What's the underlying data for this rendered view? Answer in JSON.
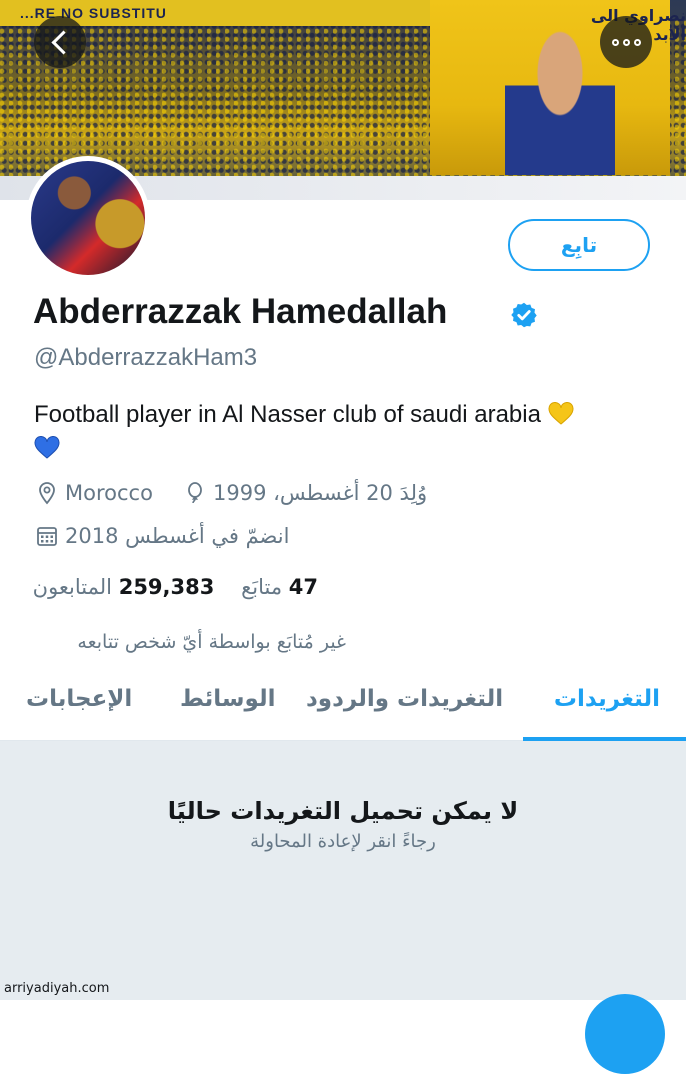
{
  "header": {
    "banner_stripe_text": "...RE NO SUBSTITU",
    "tifo_text": "نصراوي الى الابد"
  },
  "profile": {
    "name": "Abderrazzak Hamedallah",
    "verified": true,
    "handle": "@AbderrazzakHam3",
    "bio": "Football player in Al Nasser club of saudi arabia",
    "follow_label": "تابِع",
    "location": "Morocco",
    "born": "وُلِدَ 20 أغسطس، 1999",
    "joined": "انضمّ في أغسطس 2018",
    "following_count": "47",
    "following_label": "متابَع",
    "followers_count": "259,383",
    "followers_label": "المتابعون",
    "not_followed": "غير مُتابَع بواسطة أيّ شخص تتابعه"
  },
  "tabs": [
    {
      "label": "التغريدات",
      "active": true
    },
    {
      "label": "التغريدات والردود",
      "active": false
    },
    {
      "label": "الوسائط",
      "active": false
    },
    {
      "label": "الإعجابات",
      "active": false
    }
  ],
  "feed": {
    "error_title": "لا يمكن تحميل التغريدات حاليًا",
    "error_subtitle": "رجاءً انقر لإعادة المحاولة"
  },
  "watermark": "arriyadiyah.com",
  "colors": {
    "accent": "#1da1f2",
    "muted_text": "#657786",
    "feed_background": "#e6ecf0",
    "heart_yellow": "#f5c518",
    "heart_blue": "#2f6fe4"
  },
  "icons": [
    "back-chevron-icon",
    "more-options-icon",
    "verified-badge-icon",
    "location-pin-icon",
    "balloon-icon",
    "calendar-icon",
    "yellow-heart-icon",
    "blue-heart-icon"
  ]
}
